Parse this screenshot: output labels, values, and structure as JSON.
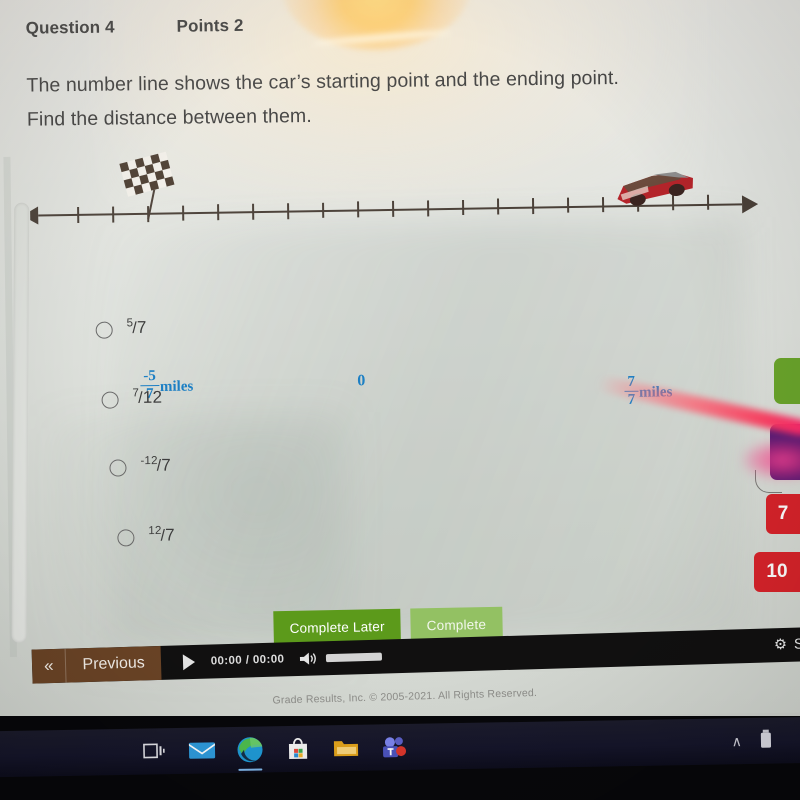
{
  "question": {
    "number_label": "Question 4",
    "points_label": "Points 2",
    "prompt_line1": "The number line shows the car’s starting point and the ending point.",
    "prompt_line2": "Find the distance between them."
  },
  "number_line": {
    "left_point": {
      "numerator": "-5",
      "denominator": "7",
      "units": "miles",
      "icon": "checkered-flag-icon"
    },
    "origin_label": "0",
    "right_point": {
      "numerator": "7",
      "denominator": "7",
      "units": "miles",
      "icon": "race-car-icon"
    },
    "tick_count": 19,
    "label_color": "#1c7fc4",
    "axis_color": "#4a4038"
  },
  "options": [
    {
      "id": "a",
      "numerator": "5",
      "slash": "/",
      "denominator": "7",
      "selected": false
    },
    {
      "id": "b",
      "numerator": "7",
      "slash": "/",
      "denominator": "12",
      "selected": false
    },
    {
      "id": "c",
      "numerator": "-12",
      "slash": "/",
      "denominator": "7",
      "selected": false
    },
    {
      "id": "d",
      "numerator": "12",
      "slash": "/",
      "denominator": "7",
      "selected": false
    }
  ],
  "actions": {
    "complete_later": "Complete Later",
    "complete": "Complete",
    "complete_later_color": "#5c9a1b",
    "complete_color": "#93c163"
  },
  "player": {
    "prev_chevron": "«",
    "prev_label": "Previous",
    "play_icon": "play-icon",
    "time": "00:00 / 00:00",
    "speaker_icon": "speaker-icon",
    "settings_gear": "⚙",
    "settings_label": "Se",
    "bar_color": "#111010",
    "prev_color": "#6b4426"
  },
  "footer": {
    "copyright": "Grade Results, Inc. © 2005-2021. All Rights Reserved."
  },
  "right_edge": {
    "badge_7": "7",
    "badge_10": "10",
    "tab_green_color": "#6aa52b",
    "tab_purple_color": "#5c1d77",
    "badge_color": "#d8232a"
  },
  "taskbar": {
    "items": [
      {
        "name": "task-view-icon",
        "label": ""
      },
      {
        "name": "mail-icon",
        "label": ""
      },
      {
        "name": "microsoft-edge-icon",
        "label": ""
      },
      {
        "name": "microsoft-store-icon",
        "label": ""
      },
      {
        "name": "file-explorer-icon",
        "label": ""
      },
      {
        "name": "microsoft-teams-icon",
        "label": ""
      }
    ],
    "tray": [
      {
        "name": "show-hidden-icons-chevron",
        "glyph": "∧"
      },
      {
        "name": "battery-icon",
        "glyph": ""
      }
    ]
  }
}
